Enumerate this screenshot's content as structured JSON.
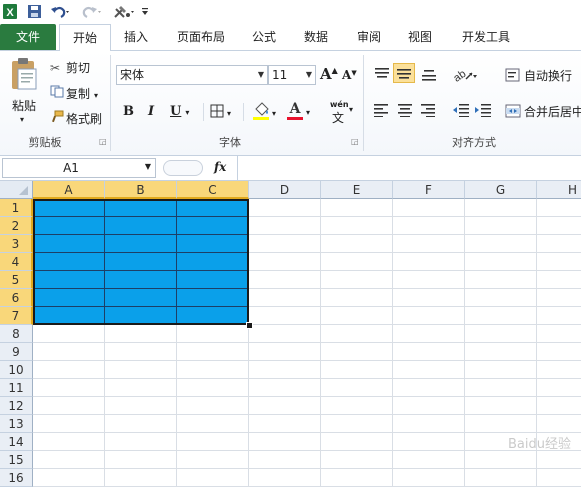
{
  "quick_access": {
    "icons": [
      "excel-icon",
      "save-icon",
      "undo-icon",
      "redo-icon",
      "custom-tools-icon",
      "customize-qat-icon"
    ]
  },
  "tabs": [
    {
      "label": "文件"
    },
    {
      "label": "开始"
    },
    {
      "label": "插入"
    },
    {
      "label": "页面布局"
    },
    {
      "label": "公式"
    },
    {
      "label": "数据"
    },
    {
      "label": "审阅"
    },
    {
      "label": "视图"
    },
    {
      "label": "开发工具"
    }
  ],
  "clipboard": {
    "paste": "粘贴",
    "cut": "剪切",
    "copy": "复制",
    "format_painter": "格式刷",
    "group_label": "剪贴板"
  },
  "font": {
    "name": "宋体",
    "size": "11",
    "bold": "B",
    "italic": "I",
    "underline": "U",
    "grow": "A",
    "shrink": "A",
    "font_color_letter": "A",
    "phonetic": "wén",
    "phonetic_char": "文",
    "group_label": "字体",
    "fill_color": "#ffff00",
    "font_color": "#e8112d"
  },
  "alignment": {
    "wrap_text": "自动换行",
    "merge_center": "合并后居中",
    "group_label": "对齐方式"
  },
  "formula_bar": {
    "name_box": "A1",
    "fx": "fx",
    "value": ""
  },
  "grid": {
    "columns": [
      "A",
      "B",
      "C",
      "D",
      "E",
      "F",
      "G",
      "H"
    ],
    "rows": [
      "1",
      "2",
      "3",
      "4",
      "5",
      "6",
      "7",
      "8",
      "9",
      "10",
      "11",
      "12",
      "13",
      "14",
      "15",
      "16"
    ],
    "fill_color": "#0aa0ea",
    "selection": "A1:C7"
  },
  "watermark": "Baidu经验"
}
